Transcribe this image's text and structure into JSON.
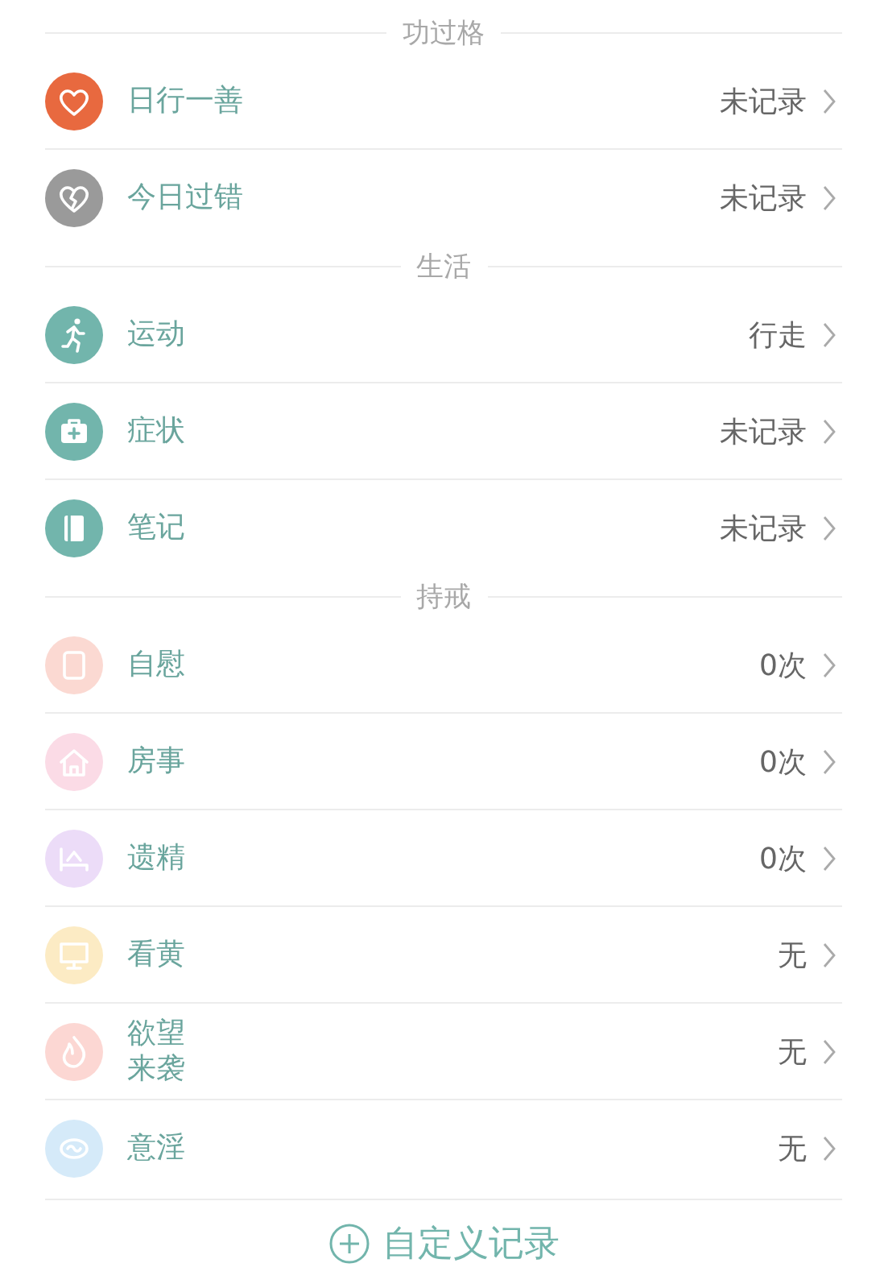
{
  "sections": [
    {
      "title": "功过格",
      "rows": [
        {
          "kind": "heart",
          "color": "#e8693f",
          "label": "日行一善",
          "value": "未记录"
        },
        {
          "kind": "brokenheart",
          "color": "#9a9a9a",
          "label": "今日过错",
          "value": "未记录"
        }
      ]
    },
    {
      "title": "生活",
      "rows": [
        {
          "kind": "runner",
          "color": "#72b5ac",
          "label": "运动",
          "value": "行走"
        },
        {
          "kind": "medkit",
          "color": "#72b5ac",
          "label": "症状",
          "value": "未记录"
        },
        {
          "kind": "notebook",
          "color": "#72b5ac",
          "label": "笔记",
          "value": "未记录"
        }
      ]
    },
    {
      "title": "持戒",
      "rows": [
        {
          "kind": "cup",
          "color": "#fbd9d2",
          "label": "自慰",
          "value": "0次"
        },
        {
          "kind": "house",
          "color": "#fbdbe6",
          "label": "房事",
          "value": "0次"
        },
        {
          "kind": "bed",
          "color": "#ecdcf8",
          "label": "遗精",
          "value": "0次"
        },
        {
          "kind": "screen",
          "color": "#fcebc4",
          "label": "看黄",
          "value": "无"
        },
        {
          "kind": "flame",
          "color": "#fcd7d3",
          "label": "欲望来袭",
          "value": "无"
        },
        {
          "kind": "cloud",
          "color": "#d5eaf9",
          "label": "意淫",
          "value": "无"
        }
      ]
    }
  ],
  "footer": {
    "label": "自定义记录"
  }
}
